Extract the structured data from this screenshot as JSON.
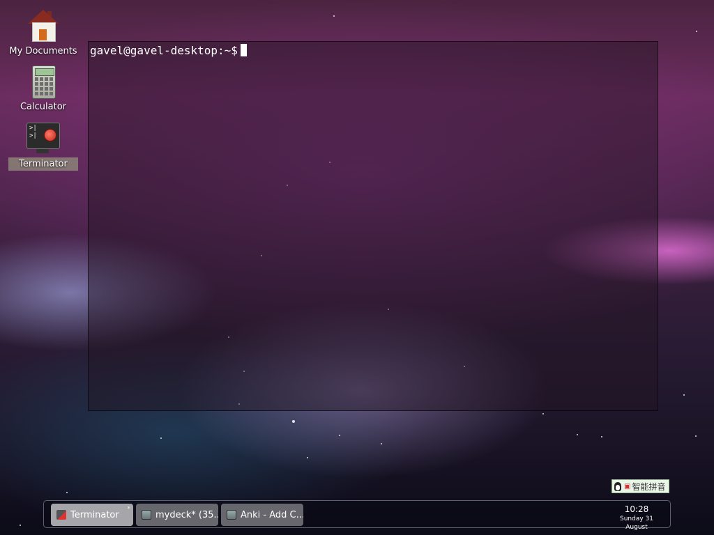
{
  "desktop": {
    "icons": [
      {
        "label": "My Documents",
        "icon": "home-folder-icon"
      },
      {
        "label": "Calculator",
        "icon": "calculator-icon"
      },
      {
        "label": "Terminator",
        "icon": "terminator-icon",
        "selected": true
      }
    ]
  },
  "terminal": {
    "prompt": "gavel@gavel-desktop:~$"
  },
  "ime": {
    "label": "智能拼音"
  },
  "taskbar": {
    "tasks": [
      {
        "label": "Terminator",
        "active": true,
        "icon": "terminator-icon"
      },
      {
        "label": "mydeck* (35...",
        "active": false,
        "icon": "anki-icon"
      },
      {
        "label": "Anki - Add C...",
        "active": false,
        "icon": "anki-icon"
      }
    ],
    "clock": {
      "time": "10:28",
      "date": "Sunday 31 August"
    }
  }
}
